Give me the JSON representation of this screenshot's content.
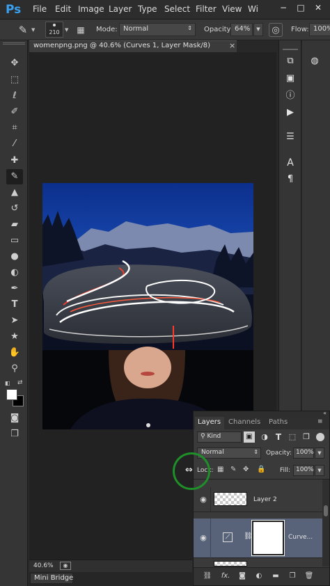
{
  "app": {
    "logo": "Ps",
    "menu": [
      "File",
      "Edit",
      "Image",
      "Layer",
      "Type",
      "Select",
      "Filter",
      "View",
      "Wi"
    ],
    "window_controls": [
      "−",
      "□",
      "✕"
    ]
  },
  "options_bar": {
    "brush_size": "210",
    "mode_label": "Mode:",
    "mode_value": "Normal",
    "opacity_label": "Opacity:",
    "opacity_value": "64%",
    "flow_label": "Flow:",
    "flow_value": "100%"
  },
  "document": {
    "tab_title": "womenpng.png @ 40.6% (Curves 1, Layer Mask/8)",
    "zoom": "40.6%",
    "mini_bridge": "Mini Bridge"
  },
  "layers_panel": {
    "tabs": [
      "Layers",
      "Channels",
      "Paths"
    ],
    "filter_kind": "Kind",
    "blend_mode": "Normal",
    "opacity_label": "Opacity:",
    "opacity_value": "100%",
    "lock_label": "Lock:",
    "fill_label": "Fill:",
    "fill_value": "100%",
    "layers": [
      {
        "name": "Layer 2"
      },
      {
        "name": "Curve..."
      }
    ]
  },
  "colors": {
    "ps_blue": "#3aa0f0",
    "selected_layer": "#58637a",
    "annotation_circle": "#1f8f2a"
  },
  "icons": {
    "tools": [
      "move-tool-icon",
      "marquee-tool-icon",
      "lasso-tool-icon",
      "quick-selection-icon",
      "crop-tool-icon",
      "eyedropper-icon",
      "healing-brush-icon",
      "brush-tool-icon",
      "clone-stamp-icon",
      "history-brush-icon",
      "eraser-icon",
      "gradient-icon",
      "blur-tool-icon",
      "dodge-tool-icon",
      "pen-tool-icon",
      "type-tool-icon",
      "path-selection-icon",
      "shape-tool-icon",
      "hand-tool-icon",
      "zoom-tool-icon"
    ],
    "dock": [
      "history-icon",
      "properties-icon",
      "info-icon",
      "actions-icon",
      "adjustments-icon",
      "character-icon",
      "paragraph-icon",
      "navigator-icon"
    ]
  }
}
